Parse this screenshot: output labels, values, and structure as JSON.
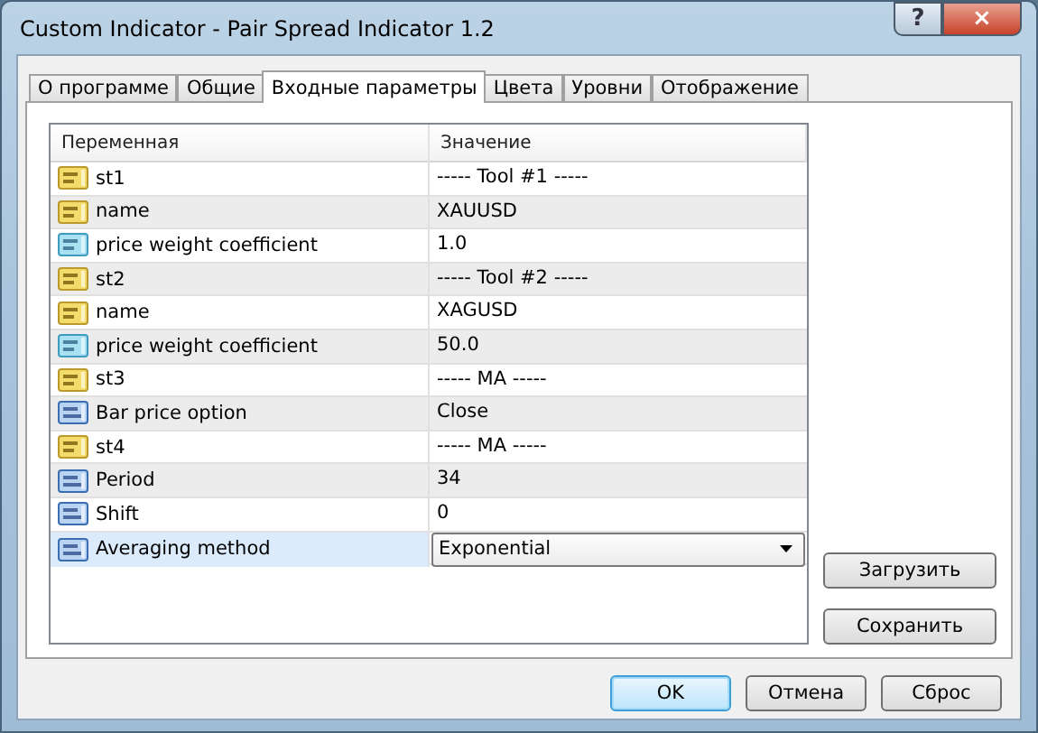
{
  "window": {
    "title": "Custom Indicator - Pair Spread Indicator 1.2",
    "help": "?",
    "close": "×"
  },
  "tabs": [
    {
      "label": "О программе",
      "selected": false
    },
    {
      "label": "Общие",
      "selected": false
    },
    {
      "label": "Входные параметры",
      "selected": true
    },
    {
      "label": "Цвета",
      "selected": false
    },
    {
      "label": "Уровни",
      "selected": false
    },
    {
      "label": "Отображение",
      "selected": false
    }
  ],
  "table": {
    "columns": [
      "Переменная",
      "Значение"
    ],
    "rows": [
      {
        "kind": "string",
        "name": "st1",
        "value": "----- Tool #1 -----",
        "selected": false
      },
      {
        "kind": "string",
        "name": "name",
        "value": "XAUUSD",
        "selected": false
      },
      {
        "kind": "double",
        "name": "price weight coefficient",
        "value": "1.0",
        "selected": false
      },
      {
        "kind": "string",
        "name": "st2",
        "value": "----- Tool #2 -----",
        "selected": false
      },
      {
        "kind": "string",
        "name": "name",
        "value": "XAGUSD",
        "selected": false
      },
      {
        "kind": "double",
        "name": "price weight coefficient",
        "value": "50.0",
        "selected": false
      },
      {
        "kind": "string",
        "name": "st3",
        "value": "----- MA -----",
        "selected": false
      },
      {
        "kind": "int",
        "name": "Bar price option",
        "value": "Close",
        "selected": false
      },
      {
        "kind": "string",
        "name": "st4",
        "value": "----- MA -----",
        "selected": false
      },
      {
        "kind": "int",
        "name": "Period",
        "value": "34",
        "selected": false
      },
      {
        "kind": "int",
        "name": "Shift",
        "value": "0",
        "selected": false
      },
      {
        "kind": "int",
        "name": "Averaging method",
        "value": "Exponential",
        "selected": true
      }
    ]
  },
  "side_buttons": [
    "Загрузить",
    "Сохранить"
  ],
  "buttons": [
    {
      "label": "OK",
      "default": true
    },
    {
      "label": "Отмена",
      "default": false
    },
    {
      "label": "Сброс",
      "default": false
    }
  ]
}
